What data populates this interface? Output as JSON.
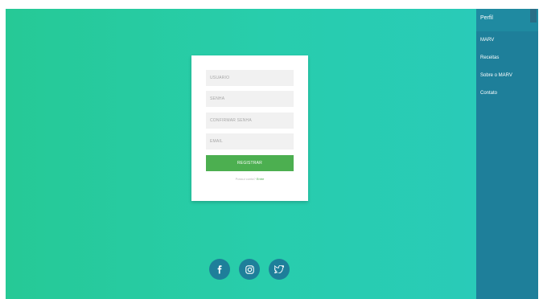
{
  "sidebar": {
    "title": "Perfil",
    "items": [
      {
        "label": "MARV"
      },
      {
        "label": "Receitas"
      },
      {
        "label": "Sobre o MARV"
      },
      {
        "label": "Contato"
      }
    ]
  },
  "form": {
    "username_placeholder": "USUARIO",
    "password_placeholder": "SENHA",
    "confirm_password_placeholder": "CONFIRMAR SENHA",
    "email_placeholder": "EMAIL",
    "register_label": "REGISTRAR",
    "login_prompt": "Possui conta?",
    "login_link": "Entre"
  },
  "social": {
    "icons": [
      "facebook-icon",
      "instagram-icon",
      "twitter-icon"
    ]
  },
  "footer": {
    "text": ""
  },
  "colors": {
    "gradient_start": "#26c996",
    "gradient_end": "#29cbb8",
    "sidebar": "#1e7f9a",
    "sidebar_header": "#1f8aa1",
    "button": "#4caf50",
    "social_button": "#1e7f9a"
  }
}
